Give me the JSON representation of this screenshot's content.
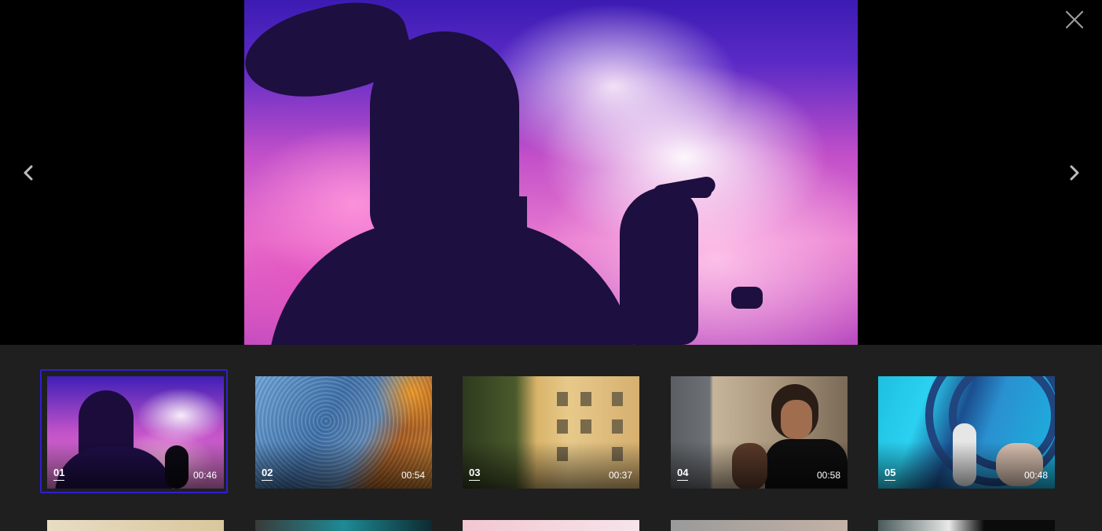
{
  "viewer": {
    "prev_icon": "chevron-left-icon",
    "next_icon": "chevron-right-icon",
    "close_icon": "close-icon",
    "prev_glyph": "‹",
    "next_glyph": "›"
  },
  "thumbnails": [
    {
      "number": "01",
      "duration": "00:46",
      "selected": true
    },
    {
      "number": "02",
      "duration": "00:54",
      "selected": false
    },
    {
      "number": "03",
      "duration": "00:37",
      "selected": false
    },
    {
      "number": "04",
      "duration": "00:58",
      "selected": false
    },
    {
      "number": "05",
      "duration": "00:48",
      "selected": false
    }
  ],
  "colors": {
    "selection_border": "#2f1fd0",
    "strip_background": "#1f1f1f",
    "viewer_background": "#000000"
  }
}
